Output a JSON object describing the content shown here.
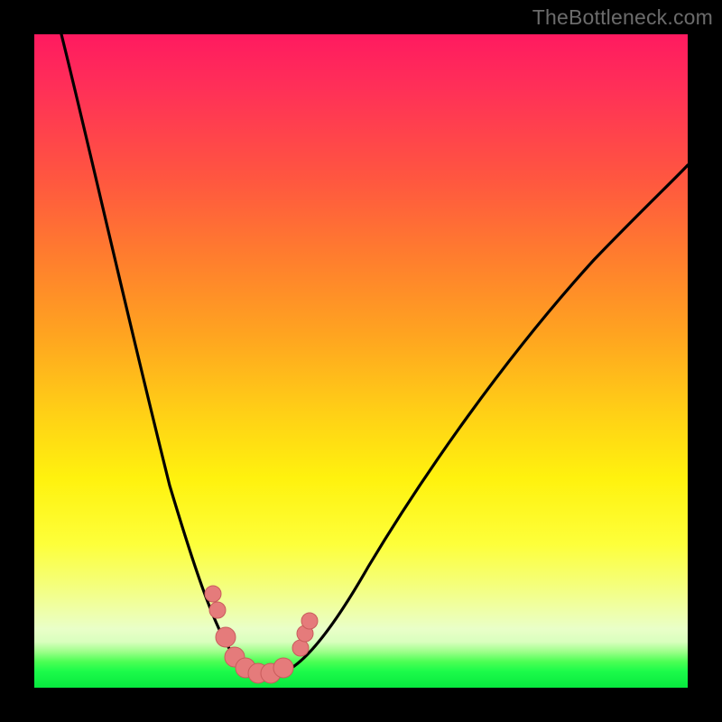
{
  "watermark": "TheBottleneck.com",
  "colors": {
    "background": "#000000",
    "curve": "#000000",
    "marker_fill": "#e57b7b",
    "marker_stroke": "#c95c5c",
    "gradient_stops": [
      "#ff1a60",
      "#ff2f58",
      "#ff5640",
      "#ff7d2e",
      "#ffa420",
      "#ffd016",
      "#fff20e",
      "#fdff3a",
      "#f5ff78",
      "#efffa6",
      "#e9ffc8",
      "#d9ffbe",
      "#9dff8a",
      "#4dff55",
      "#1cfb4a",
      "#07e83e"
    ]
  },
  "chart_data": {
    "type": "line",
    "title": "",
    "xlabel": "",
    "ylabel": "",
    "x_range": [
      0,
      1
    ],
    "y_range": [
      0,
      1
    ],
    "note": "Axes are un-ticked; values are normalized 0–1. y=1 is top (red), y≈0 is the green optimum band. The curve is a sharp V with its trough near x≈0.34.",
    "series": [
      {
        "name": "bottleneck-curve",
        "x": [
          0.04,
          0.08,
          0.12,
          0.16,
          0.2,
          0.24,
          0.28,
          0.3,
          0.32,
          0.34,
          0.36,
          0.38,
          0.4,
          0.45,
          0.55,
          0.65,
          0.75,
          0.85,
          0.95,
          1.0
        ],
        "y": [
          1.0,
          0.86,
          0.72,
          0.58,
          0.44,
          0.3,
          0.14,
          0.08,
          0.04,
          0.02,
          0.02,
          0.04,
          0.07,
          0.14,
          0.29,
          0.43,
          0.55,
          0.66,
          0.76,
          0.8
        ]
      }
    ],
    "markers": {
      "name": "highlighted-points",
      "color": "#e57b7b",
      "points": [
        {
          "x": 0.275,
          "y": 0.145
        },
        {
          "x": 0.28,
          "y": 0.12
        },
        {
          "x": 0.295,
          "y": 0.07
        },
        {
          "x": 0.305,
          "y": 0.048
        },
        {
          "x": 0.32,
          "y": 0.03
        },
        {
          "x": 0.335,
          "y": 0.022
        },
        {
          "x": 0.35,
          "y": 0.022
        },
        {
          "x": 0.365,
          "y": 0.028
        },
        {
          "x": 0.398,
          "y": 0.06
        },
        {
          "x": 0.405,
          "y": 0.08
        },
        {
          "x": 0.412,
          "y": 0.1
        }
      ]
    }
  }
}
